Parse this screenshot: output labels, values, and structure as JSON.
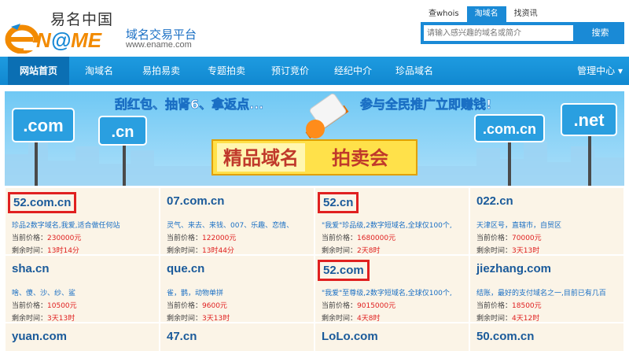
{
  "header": {
    "logo_cn": "易名中国",
    "logo_en": "ENAME",
    "tagline": "域名交易平台",
    "url": "www.ename.com"
  },
  "search": {
    "tabs": [
      "查whois",
      "淘域名",
      "找资讯"
    ],
    "active_tab": "淘域名",
    "placeholder": "请输入感兴趣的域名或简介",
    "button": "搜索"
  },
  "nav": {
    "items": [
      "网站首页",
      "淘域名",
      "易拍易卖",
      "专题拍卖",
      "预订竞价",
      "经纪中介",
      "珍品域名"
    ],
    "right": "管理中心"
  },
  "banner": {
    "top_text": "刮红包、抽肾6、拿返点...",
    "right_text": "参与全民推广立即赚钱!",
    "sign_com": ".com",
    "sign_cn": ".cn",
    "sign_comcn": ".com.cn",
    "sign_net": ".net",
    "headline_1": "精品域名",
    "headline_2": "拍卖会"
  },
  "labels": {
    "price": "当前价格：",
    "time": "剩余时间："
  },
  "rows": [
    [
      {
        "domain": "52.com.cn",
        "boxed": true,
        "desc": "珍品2数字域名,我爱,适合做任何站",
        "price": "230000元",
        "time": "13时14分"
      },
      {
        "domain": "07.com.cn",
        "boxed": false,
        "desc": "灵气、来去、来钱、007、乐趣、恋情、",
        "price": "122000元",
        "time": "13时44分"
      },
      {
        "domain": "52.cn",
        "boxed": true,
        "desc": "\"我爱\"珍品级,2数字短域名,全球仅100个,",
        "price": "1680000元",
        "time": "2天8时"
      },
      {
        "domain": "022.cn",
        "boxed": false,
        "desc": "天津区号，直辖市，自贸区",
        "price": "70000元",
        "time": "3天13时"
      }
    ],
    [
      {
        "domain": "sha.cn",
        "boxed": false,
        "desc": "啥、傻、沙、纱、鲨",
        "price": "10500元",
        "time": "3天13时"
      },
      {
        "domain": "que.cn",
        "boxed": false,
        "desc": "雀，鹊，动物单拼",
        "price": "9600元",
        "time": "3天13时"
      },
      {
        "domain": "52.com",
        "boxed": true,
        "desc": "\"我爱\"至尊级,2数字短域名,全球仅100个,",
        "price": "9015000元",
        "time": "4天8时"
      },
      {
        "domain": "jiezhang.com",
        "boxed": false,
        "desc": "结账，最好的支付域名之一,目前已有几百",
        "price": "18500元",
        "time": "4天12时"
      }
    ],
    [
      {
        "domain": "yuan.com",
        "boxed": false
      },
      {
        "domain": "47.cn",
        "boxed": false
      },
      {
        "domain": "LoLo.com",
        "boxed": false
      },
      {
        "domain": "50.com.cn",
        "boxed": false
      }
    ]
  ]
}
